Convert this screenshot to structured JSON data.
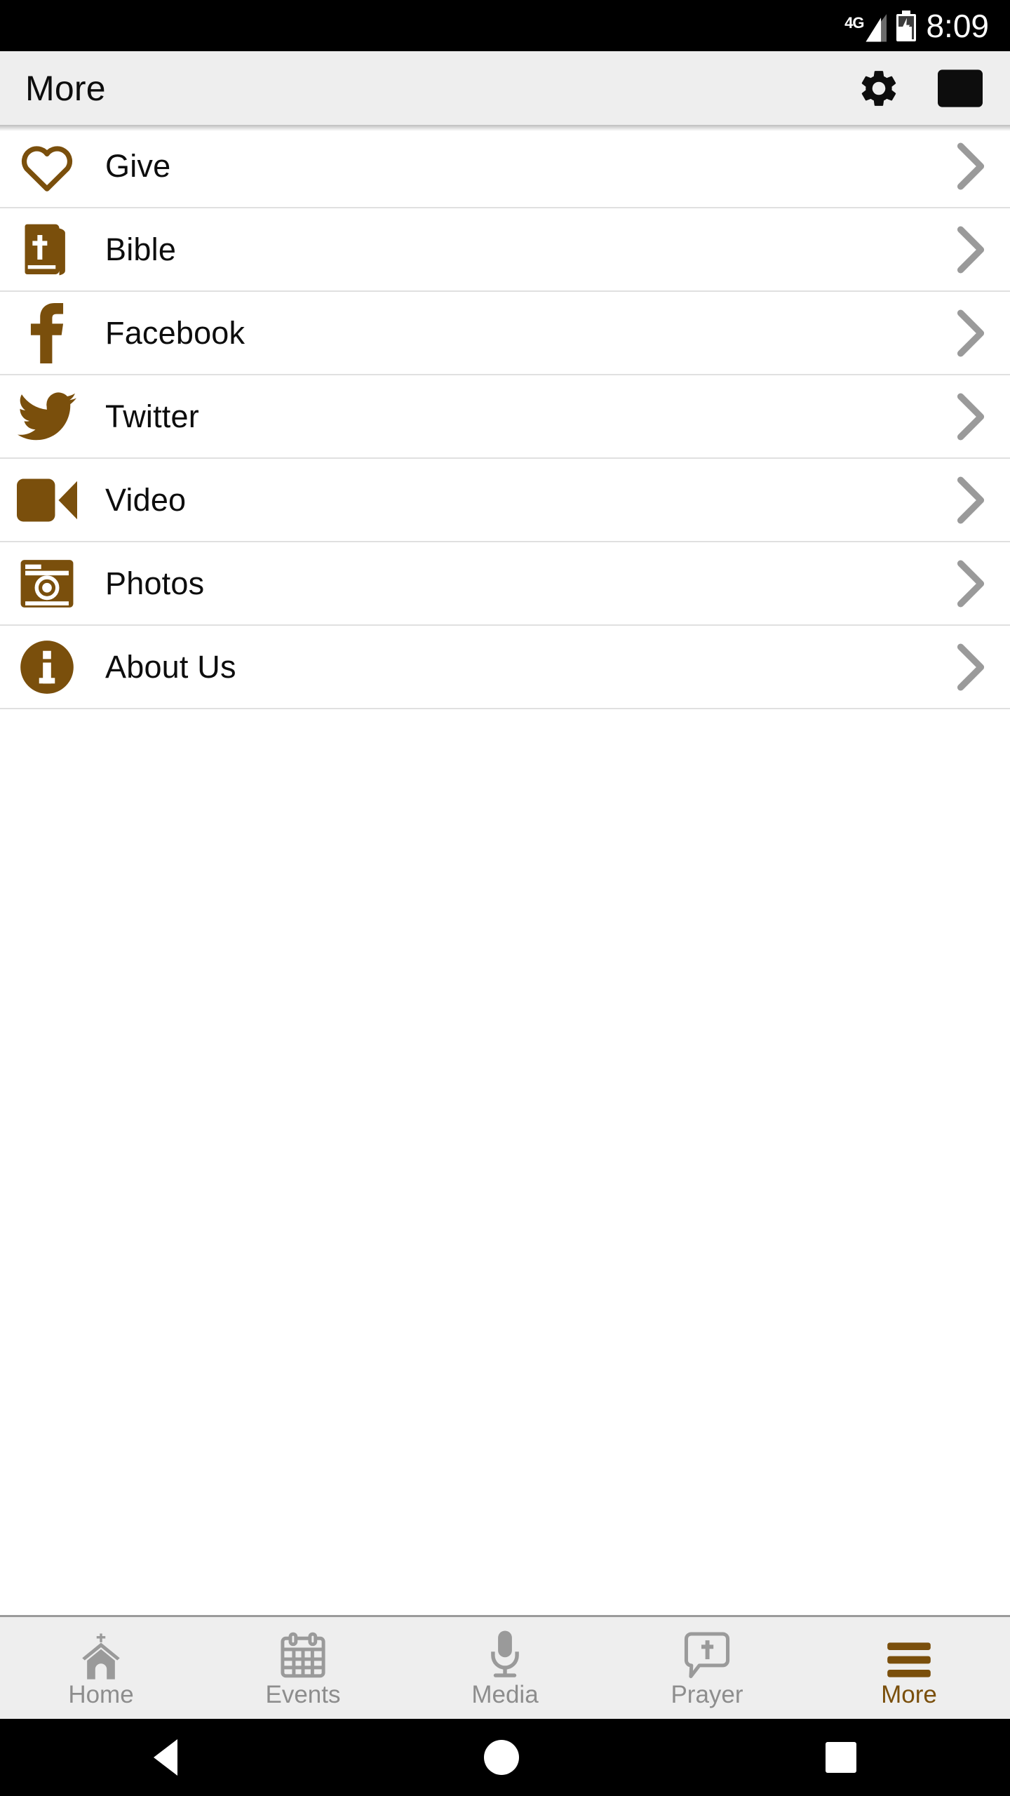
{
  "status_bar": {
    "network_label": "4G",
    "battery_icon": "battery-charging-icon",
    "signal_icon": "signal-bars-icon",
    "time": "8:09"
  },
  "header": {
    "title": "More",
    "actions": [
      {
        "name": "settings-button",
        "icon": "gear-icon"
      },
      {
        "name": "mail-button",
        "icon": "envelope-icon"
      }
    ]
  },
  "colors": {
    "accent_brown": "#7a4f0c",
    "header_bg": "#eeeeee",
    "divider": "#e0e0e0",
    "chevron": "#9a9a9a",
    "inactive_tab": "#8d8d8d"
  },
  "menu": {
    "items": [
      {
        "label": "Give",
        "icon": "heart-outline-icon",
        "chevron": "chevron-right-icon"
      },
      {
        "label": "Bible",
        "icon": "bible-book-icon",
        "chevron": "chevron-right-icon"
      },
      {
        "label": "Facebook",
        "icon": "facebook-icon",
        "chevron": "chevron-right-icon"
      },
      {
        "label": "Twitter",
        "icon": "twitter-bird-icon",
        "chevron": "chevron-right-icon"
      },
      {
        "label": "Video",
        "icon": "video-camera-icon",
        "chevron": "chevron-right-icon"
      },
      {
        "label": "Photos",
        "icon": "camera-icon",
        "chevron": "chevron-right-icon"
      },
      {
        "label": "About Us",
        "icon": "info-circle-icon",
        "chevron": "chevron-right-icon"
      }
    ]
  },
  "tabbar": {
    "tabs": [
      {
        "label": "Home",
        "icon": "church-icon",
        "active": false
      },
      {
        "label": "Events",
        "icon": "calendar-icon",
        "active": false
      },
      {
        "label": "Media",
        "icon": "microphone-icon",
        "active": false
      },
      {
        "label": "Prayer",
        "icon": "speech-bubble-cross-icon",
        "active": false
      },
      {
        "label": "More",
        "icon": "hamburger-menu-icon",
        "active": true
      }
    ]
  },
  "system_nav": {
    "back": "back-triangle-icon",
    "home": "home-circle-icon",
    "recents": "recents-square-icon"
  }
}
